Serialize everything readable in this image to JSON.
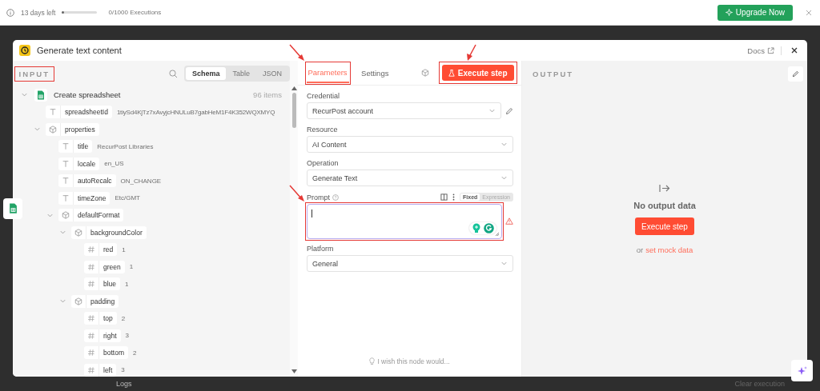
{
  "trial_bar": {
    "days_left": "13 days left",
    "level": 0.03,
    "executions": "0/1000 Executions",
    "upgrade_button": "Upgrade Now"
  },
  "background": {
    "logs_tab": "Logs",
    "clear_execution": "Clear execution"
  },
  "modal": {
    "title": "Generate text content",
    "docs_link": "Docs"
  },
  "input_panel": {
    "label": "INPUT",
    "highlighted": true,
    "view_tabs": [
      {
        "label": "Schema",
        "selected": true
      },
      {
        "label": "Table",
        "selected": false
      },
      {
        "label": "JSON",
        "selected": false
      }
    ],
    "tree": {
      "label": "Create spreadsheet",
      "count": "96 items",
      "children": [
        {
          "key": "spreadsheetId",
          "kind": "string",
          "value": "1tiySd4KjTz7xAvyjcHNULuB7gabHeM1F4K352WQXMYQ"
        },
        {
          "key": "properties",
          "kind": "object",
          "expanded": true,
          "children": [
            {
              "key": "title",
              "kind": "string",
              "value": "RecurPost Libraries"
            },
            {
              "key": "locale",
              "kind": "string",
              "value": "en_US"
            },
            {
              "key": "autoRecalc",
              "kind": "string",
              "value": "ON_CHANGE"
            },
            {
              "key": "timeZone",
              "kind": "string",
              "value": "Etc/GMT"
            },
            {
              "key": "defaultFormat",
              "kind": "object",
              "expanded": true,
              "children": [
                {
                  "key": "backgroundColor",
                  "kind": "object",
                  "expanded": true,
                  "children": [
                    {
                      "key": "red",
                      "kind": "number",
                      "value": "1"
                    },
                    {
                      "key": "green",
                      "kind": "number",
                      "value": "1"
                    },
                    {
                      "key": "blue",
                      "kind": "number",
                      "value": "1"
                    }
                  ]
                },
                {
                  "key": "padding",
                  "kind": "object",
                  "expanded": true,
                  "children": [
                    {
                      "key": "top",
                      "kind": "number",
                      "value": "2"
                    },
                    {
                      "key": "right",
                      "kind": "number",
                      "value": "3"
                    },
                    {
                      "key": "bottom",
                      "kind": "number",
                      "value": "2"
                    },
                    {
                      "key": "left",
                      "kind": "number",
                      "value": "3"
                    }
                  ]
                }
              ]
            }
          ]
        }
      ]
    }
  },
  "parameters_panel": {
    "tabs": [
      {
        "label": "Parameters",
        "selected": true,
        "highlighted": true,
        "arrow": true
      },
      {
        "label": "Settings",
        "selected": false
      }
    ],
    "execute_button": {
      "label": "Execute step",
      "highlighted": true,
      "arrow": true
    },
    "fields": [
      {
        "kind": "select",
        "label": "Credential",
        "value": "RecurPost account",
        "editable": true
      },
      {
        "kind": "select",
        "label": "Resource",
        "value": "AI Content",
        "editable": false
      },
      {
        "kind": "select",
        "label": "Operation",
        "value": "Generate Text",
        "editable": false
      },
      {
        "kind": "textarea",
        "label": "Prompt",
        "highlighted": true,
        "arrow": true,
        "warning": true,
        "modes": [
          {
            "label": "Fixed",
            "selected": true
          },
          {
            "label": "Expression",
            "selected": false
          }
        ]
      },
      {
        "kind": "select",
        "label": "Platform",
        "value": "General",
        "editable": false
      }
    ],
    "feedback": "I wish this node would..."
  },
  "output_panel": {
    "label": "OUTPUT",
    "empty_title": "No output data",
    "execute_button": "Execute step",
    "mock_prefix": "or",
    "mock_link": "set mock data"
  }
}
